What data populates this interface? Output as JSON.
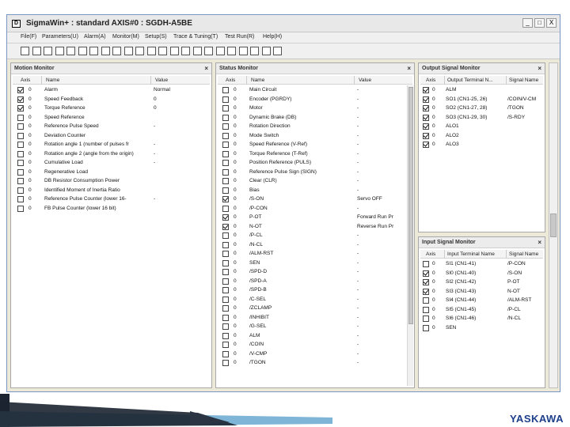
{
  "window": {
    "app_icon_letter": "D",
    "title": "SigmaWin+ : standard AXIS#0 : SGDH-A5BE",
    "controls": [
      "_",
      "□",
      "X"
    ]
  },
  "menu": [
    "File(F)",
    "Parameters(U)",
    "Alarm(A)",
    "Monitor(M)",
    "Setup(S)",
    "Trace & Tuning(T)",
    "Test Run(R)",
    "Help(H)"
  ],
  "toolbar_icons": [
    "select-icon",
    "checkbox-icon",
    "edit-icon",
    "record-icon",
    "save-icon",
    "search-icon",
    "list-icon",
    "compare-icon",
    "transfer-icon",
    "cut-icon",
    "copy-icon",
    "paste-icon",
    "monitor-icon",
    "chart-icon",
    "users-icon",
    "group-icon",
    "settings-icon",
    "trace-icon",
    "table-icon",
    "document-icon",
    "pen-icon",
    "filter-icon",
    "tool-icon"
  ],
  "motion_monitor": {
    "title": "Motion Monitor",
    "close": "×",
    "columns": [
      "Axis",
      "Name",
      "Value"
    ],
    "rows": [
      {
        "checked": true,
        "axis": "0",
        "name": "Alarm",
        "value": "Normal"
      },
      {
        "checked": true,
        "axis": "0",
        "name": "Speed Feedback",
        "value": "0"
      },
      {
        "checked": true,
        "axis": "0",
        "name": "Torque Reference",
        "value": "0"
      },
      {
        "checked": false,
        "axis": "0",
        "name": "Speed Reference",
        "value": ""
      },
      {
        "checked": false,
        "axis": "0",
        "name": "Reference Pulse Speed",
        "value": "-"
      },
      {
        "checked": false,
        "axis": "0",
        "name": "Deviation Counter",
        "value": ""
      },
      {
        "checked": false,
        "axis": "0",
        "name": "Rotation angle 1 (number of pulses fr",
        "value": "-"
      },
      {
        "checked": false,
        "axis": "0",
        "name": "Rotation angle 2 (angle from the origin)",
        "value": "-"
      },
      {
        "checked": false,
        "axis": "0",
        "name": "Cumulative Load",
        "value": "-"
      },
      {
        "checked": false,
        "axis": "0",
        "name": "Regenerative Load",
        "value": ""
      },
      {
        "checked": false,
        "axis": "0",
        "name": "DB Resistor Consumption Power",
        "value": ""
      },
      {
        "checked": false,
        "axis": "0",
        "name": "Identified Moment of Inertia Ratio",
        "value": ""
      },
      {
        "checked": false,
        "axis": "0",
        "name": "Reference Pulse Counter (lower 16-",
        "value": "-"
      },
      {
        "checked": false,
        "axis": "0",
        "name": "FB Pulse Counter (lower 16 bit)",
        "value": ""
      }
    ]
  },
  "status_monitor": {
    "title": "Status Monitor",
    "close": "×",
    "columns": [
      "Axis",
      "Name",
      "Value"
    ],
    "rows": [
      {
        "checked": false,
        "axis": "0",
        "name": "Main Circuit",
        "value": "-"
      },
      {
        "checked": false,
        "axis": "0",
        "name": "Encoder (PGRDY)",
        "value": "-"
      },
      {
        "checked": false,
        "axis": "0",
        "name": "Motor",
        "value": "-"
      },
      {
        "checked": false,
        "axis": "0",
        "name": "Dynamic Brake (DB)",
        "value": "-"
      },
      {
        "checked": false,
        "axis": "0",
        "name": "Rotation Direction",
        "value": "-"
      },
      {
        "checked": false,
        "axis": "0",
        "name": "Mode Switch",
        "value": "-"
      },
      {
        "checked": false,
        "axis": "0",
        "name": "Speed Reference (V-Ref)",
        "value": "-"
      },
      {
        "checked": false,
        "axis": "0",
        "name": "Torque Reference (T-Ref)",
        "value": "-"
      },
      {
        "checked": false,
        "axis": "0",
        "name": "Position Reference (PULS)",
        "value": "-"
      },
      {
        "checked": false,
        "axis": "0",
        "name": "Reference Pulse Sign (SIGN)",
        "value": "-"
      },
      {
        "checked": false,
        "axis": "0",
        "name": "Clear (CLR)",
        "value": "-"
      },
      {
        "checked": false,
        "axis": "0",
        "name": "Bias",
        "value": "-"
      },
      {
        "checked": true,
        "axis": "0",
        "name": "/S-ON",
        "value": "Servo OFF"
      },
      {
        "checked": false,
        "axis": "0",
        "name": "/P-CON",
        "value": "-"
      },
      {
        "checked": true,
        "axis": "0",
        "name": "P-OT",
        "value": "Forward Run Pr"
      },
      {
        "checked": true,
        "axis": "0",
        "name": "N-OT",
        "value": "Reverse Run Pr"
      },
      {
        "checked": false,
        "axis": "0",
        "name": "/P-CL",
        "value": "-"
      },
      {
        "checked": false,
        "axis": "0",
        "name": "/N-CL",
        "value": "-"
      },
      {
        "checked": false,
        "axis": "0",
        "name": "/ALM-RST",
        "value": "-"
      },
      {
        "checked": false,
        "axis": "0",
        "name": "SEN",
        "value": "-"
      },
      {
        "checked": false,
        "axis": "0",
        "name": "/SPD-D",
        "value": "-"
      },
      {
        "checked": false,
        "axis": "0",
        "name": "/SPD-A",
        "value": "-"
      },
      {
        "checked": false,
        "axis": "0",
        "name": "/SPD-B",
        "value": "-"
      },
      {
        "checked": false,
        "axis": "0",
        "name": "/C-SEL",
        "value": "-"
      },
      {
        "checked": false,
        "axis": "0",
        "name": "/ZCLAMP",
        "value": "-"
      },
      {
        "checked": false,
        "axis": "0",
        "name": "/INHIBIT",
        "value": "-"
      },
      {
        "checked": false,
        "axis": "0",
        "name": "/G-SEL",
        "value": "-"
      },
      {
        "checked": false,
        "axis": "0",
        "name": "ALM",
        "value": "-"
      },
      {
        "checked": false,
        "axis": "0",
        "name": "/COIN",
        "value": "-"
      },
      {
        "checked": false,
        "axis": "0",
        "name": "/V-CMP",
        "value": "-"
      },
      {
        "checked": false,
        "axis": "0",
        "name": "/TGON",
        "value": "-"
      }
    ]
  },
  "output_monitor": {
    "title": "Output Signal Monitor",
    "close": "×",
    "columns": [
      "Axis",
      "Output Terminal N...",
      "Signal Name"
    ],
    "rows": [
      {
        "checked": true,
        "axis": "0",
        "terminal": "ALM",
        "signal": ""
      },
      {
        "checked": true,
        "axis": "0",
        "terminal": "SO1 (CN1-25, 26)",
        "signal": "/COIN/V-CM"
      },
      {
        "checked": true,
        "axis": "0",
        "terminal": "SO2 (CN1-27, 28)",
        "signal": "/TGON"
      },
      {
        "checked": true,
        "axis": "0",
        "terminal": "SO3 (CN1-29, 30)",
        "signal": "/S-RDY"
      },
      {
        "checked": true,
        "axis": "0",
        "terminal": "ALO1",
        "signal": ""
      },
      {
        "checked": true,
        "axis": "0",
        "terminal": "ALO2",
        "signal": ""
      },
      {
        "checked": true,
        "axis": "0",
        "terminal": "ALO3",
        "signal": ""
      }
    ]
  },
  "input_monitor": {
    "title": "Input Signal Monitor",
    "close": "×",
    "columns": [
      "Axis",
      "Input Terminal Name",
      "Signal Name"
    ],
    "rows": [
      {
        "checked": false,
        "axis": "0",
        "terminal": "SI1 (CN1-41)",
        "signal": "/P-CON"
      },
      {
        "checked": true,
        "axis": "0",
        "terminal": "SI0 (CN1-40)",
        "signal": "/S-ON"
      },
      {
        "checked": true,
        "axis": "0",
        "terminal": "SI2 (CN1-42)",
        "signal": "P-OT"
      },
      {
        "checked": true,
        "axis": "0",
        "terminal": "SI3 (CN1-43)",
        "signal": "N-OT"
      },
      {
        "checked": false,
        "axis": "0",
        "terminal": "SI4 (CN1-44)",
        "signal": "/ALM-RST"
      },
      {
        "checked": false,
        "axis": "0",
        "terminal": "SI5 (CN1-45)",
        "signal": "/P-CL"
      },
      {
        "checked": false,
        "axis": "0",
        "terminal": "SI6 (CN1-46)",
        "signal": "/N-CL"
      },
      {
        "checked": false,
        "axis": "0",
        "terminal": "SEN",
        "signal": ""
      }
    ]
  },
  "brand": {
    "logo_text": "YASKAWA",
    "colors": {
      "logo": "#1d3f8a",
      "accent": "#7fb5d6",
      "dark": "#1b2430"
    }
  }
}
